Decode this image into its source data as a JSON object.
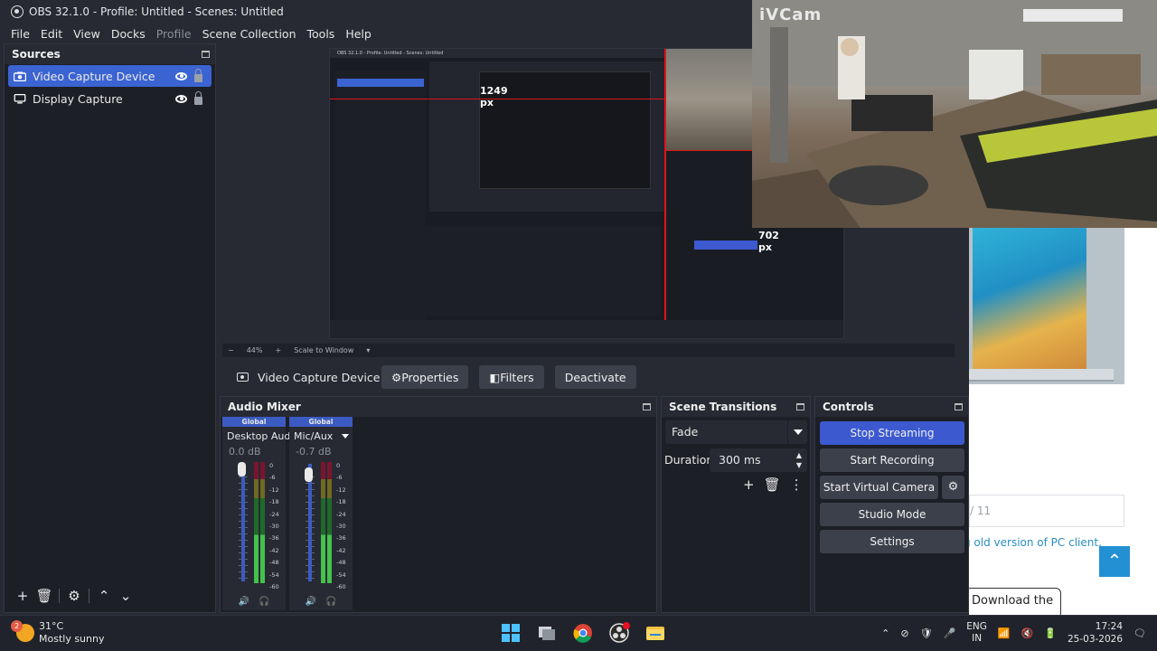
{
  "window": {
    "title": "OBS 32.1.0 - Profile: Untitled - Scenes: Untitled"
  },
  "menu": [
    "File",
    "Edit",
    "View",
    "Docks",
    "Profile",
    "Scene Collection",
    "Tools",
    "Help"
  ],
  "sources": {
    "title": "Sources",
    "items": [
      {
        "label": "Video Capture Device",
        "icon": "camera-icon",
        "selected": true
      },
      {
        "label": "Display Capture",
        "icon": "monitor-icon",
        "selected": false
      }
    ]
  },
  "preview": {
    "inner_title": "OBS 32.1.0 - Profile: Untitled - Scenes: Untitled",
    "measure_label": "1249 px",
    "measure_label2": "702 px",
    "zoom": "44%",
    "scale_mode": "Scale to Window"
  },
  "properties_bar": {
    "source_name": "Video Capture Device",
    "properties_label": "Properties",
    "filters_label": "Filters",
    "deactivate_label": "Deactivate"
  },
  "audio_mixer": {
    "title": "Audio Mixer",
    "channels": [
      {
        "badge": "Global",
        "name": "Desktop Audio",
        "db": "0.0 dB"
      },
      {
        "badge": "Global",
        "name": "Mic/Aux",
        "db": "-0.7 dB"
      }
    ],
    "scale": [
      "0",
      "-6",
      "-12",
      "-18",
      "-24",
      "-30",
      "-36",
      "-42",
      "-48",
      "-54",
      "-60"
    ]
  },
  "scene_transitions": {
    "title": "Scene Transitions",
    "transition": "Fade",
    "duration_label": "Duration",
    "duration_value": "300 ms"
  },
  "controls": {
    "title": "Controls",
    "stop_streaming": "Stop Streaming",
    "start_recording": "Start Recording",
    "start_virtual_camera": "Start Virtual Camera",
    "studio_mode": "Studio Mode",
    "settings": "Settings"
  },
  "webcam": {
    "label": "iVCam"
  },
  "background_page": {
    "line_text": "/ 11",
    "link_text": "g old version of PC client.",
    "download_text": "Download the"
  },
  "taskbar": {
    "weather_badge": "2",
    "temperature": "31°C",
    "condition": "Mostly sunny",
    "lang_top": "ENG",
    "lang_bottom": "IN",
    "time": "17:24",
    "date": "25-03-2026"
  },
  "colors": {
    "accent": "#3c59d0",
    "selected": "#3b64d2",
    "panel": "#1d1f26",
    "chrome": "#272a33"
  }
}
